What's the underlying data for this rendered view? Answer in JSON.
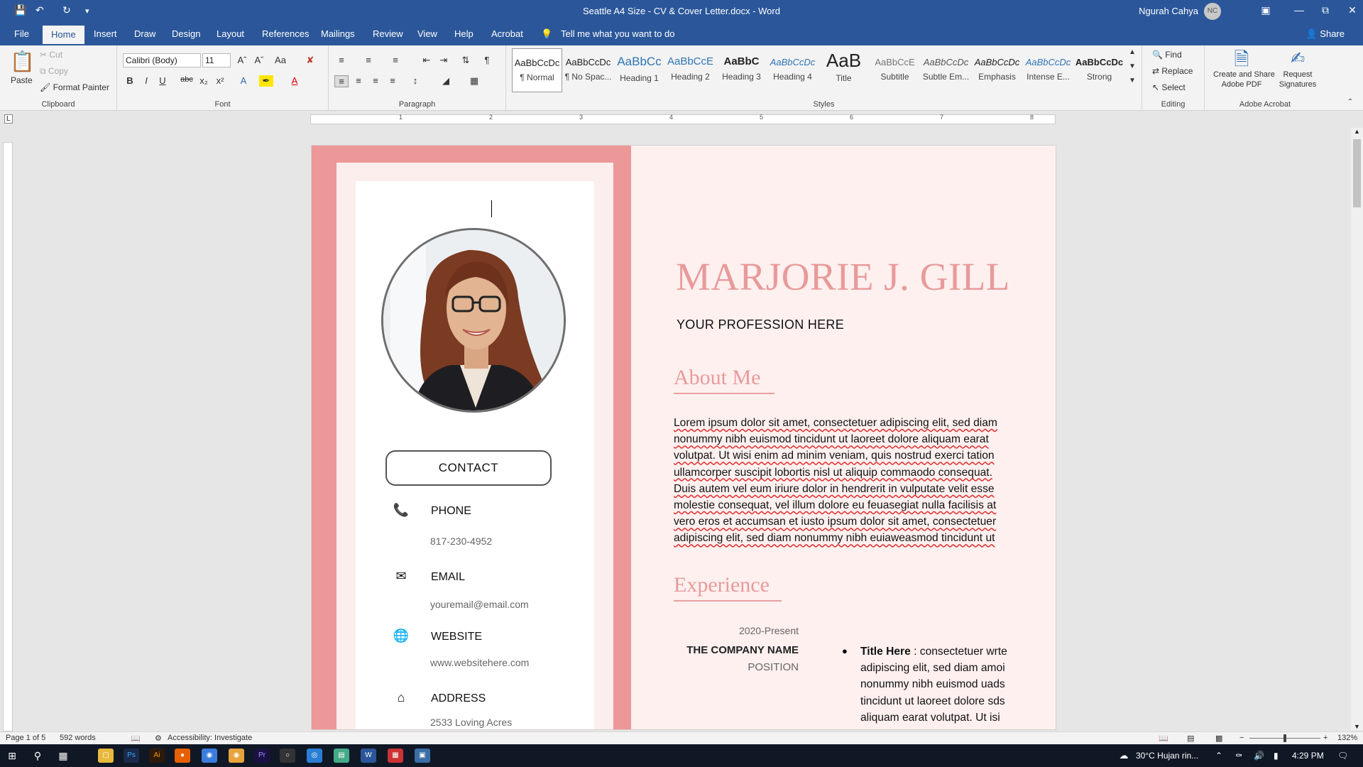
{
  "window": {
    "title": "Seattle A4 Size - CV & Cover Letter.docx - Word",
    "user_name": "Ngurah Cahya",
    "user_initials": "NC"
  },
  "tabs": [
    "File",
    "Home",
    "Insert",
    "Draw",
    "Design",
    "Layout",
    "References",
    "Mailings",
    "Review",
    "View",
    "Help",
    "Acrobat"
  ],
  "active_tab": "Home",
  "tell_me": "Tell me what you want to do",
  "share": "Share",
  "ribbon": {
    "clipboard": {
      "paste": "Paste",
      "cut": "Cut",
      "copy": "Copy",
      "format_painter": "Format Painter",
      "label": "Clipboard"
    },
    "font": {
      "name": "Calibri (Body)",
      "size": "11",
      "label": "Font",
      "change_case": "Aa"
    },
    "paragraph": {
      "label": "Paragraph"
    },
    "styles": {
      "label": "Styles",
      "items": [
        {
          "preview": "AaBbCcDc",
          "name": "¶ Normal"
        },
        {
          "preview": "AaBbCcDc",
          "name": "¶ No Spac..."
        },
        {
          "preview": "AaBbCc",
          "name": "Heading 1"
        },
        {
          "preview": "AaBbCcE",
          "name": "Heading 2"
        },
        {
          "preview": "AaBbC",
          "name": "Heading 3"
        },
        {
          "preview": "AaBbCcDc",
          "name": "Heading 4"
        },
        {
          "preview": "AaB",
          "name": "Title"
        },
        {
          "preview": "AaBbCcE",
          "name": "Subtitle"
        },
        {
          "preview": "AaBbCcDc",
          "name": "Subtle Em..."
        },
        {
          "preview": "AaBbCcDc",
          "name": "Emphasis"
        },
        {
          "preview": "AaBbCcDc",
          "name": "Intense E..."
        },
        {
          "preview": "AaBbCcDc",
          "name": "Strong"
        }
      ]
    },
    "editing": {
      "find": "Find",
      "replace": "Replace",
      "select": "Select",
      "label": "Editing"
    },
    "acrobat": {
      "create_share_1": "Create and Share",
      "create_share_2": "Adobe PDF",
      "request_1": "Request",
      "request_2": "Signatures",
      "label": "Adobe Acrobat"
    }
  },
  "ruler_numbers": [
    "1",
    "2",
    "3",
    "4",
    "5",
    "6",
    "7",
    "8"
  ],
  "resume": {
    "name": "MARJORIE J. GILL",
    "profession": "YOUR PROFESSION HERE",
    "about_heading": "About Me",
    "about_text": "Lorem ipsum dolor sit amet, consectetuer adipiscing elit, sed diam nonummy nibh euismod tincidunt ut laoreet dolore aliquam earat volutpat. Ut wisi enim ad minim veniam, quis nostrud exerci tation ullamcorper suscipit lobortis nisl ut aliquip commaodo consequat. Duis autem vel eum iriure dolor in hendrerit in vulputate velit esse molestie consequat, vel illum dolore eu feuasegiat nulla facilisis at vero eros et accumsan et iusto ipsum dolor sit amet, consectetuer adipiscing elit, sed diam nonummy nibh euiaweasmod tincidunt ut",
    "experience_heading": "Experience",
    "experience": {
      "date": "2020-Present",
      "company": "THE COMPANY NAME",
      "position": "POSITION",
      "bullet_title": "Title Here",
      "bullet_text": " : consectetuer wrte adipiscing elit, sed diam amoi nonummy nibh euismod  uads tincidunt ut laoreet dolore sds aliquam earat volutpat. Ut isi"
    },
    "contact_heading": "CONTACT",
    "contact": {
      "phone_label": "PHONE",
      "phone": "817-230-4952",
      "email_label": "EMAIL",
      "email": "youremail@email.com",
      "website_label": "WEBSITE",
      "website": "www.websitehere.com",
      "address_label": "ADDRESS",
      "address": "2533 Loving Acres"
    }
  },
  "status": {
    "page": "Page 1 of 5",
    "words": "592 words",
    "accessibility": "Accessibility: Investigate",
    "zoom": "132%"
  },
  "taskbar": {
    "weather": "30°C  Hujan rin...",
    "time": "4:29 PM"
  },
  "colors": {
    "word_blue": "#2b579a",
    "accent_pink": "#e89a9a",
    "sidebar_pink": "#ec9898",
    "page_bg": "#fdf0ef"
  }
}
